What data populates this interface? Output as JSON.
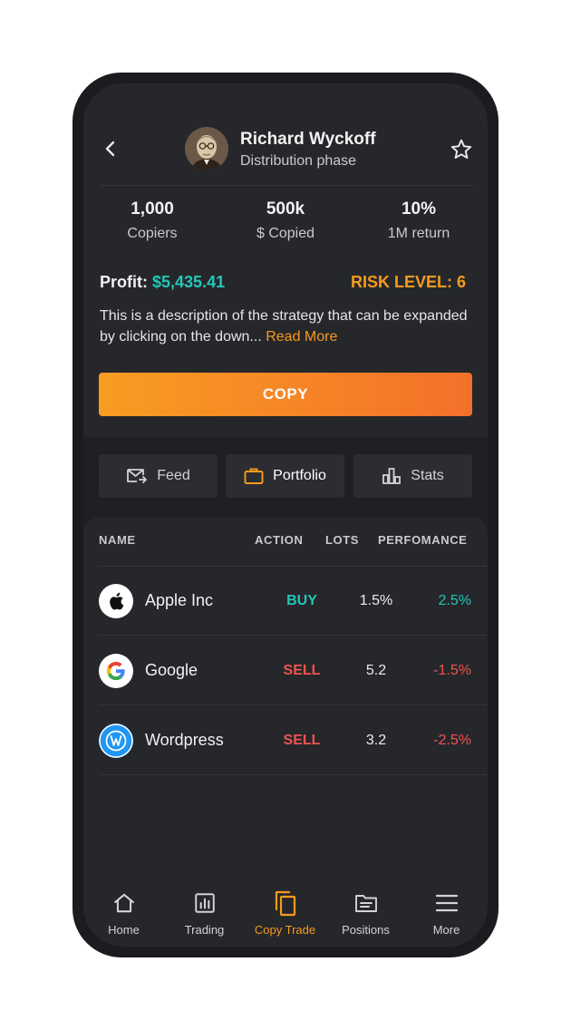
{
  "trader": {
    "name": "Richard Wyckoff",
    "subtitle": "Distribution phase"
  },
  "stats": [
    {
      "value": "1,000",
      "label": "Copiers"
    },
    {
      "value": "500k",
      "label": "$ Copied"
    },
    {
      "value": "10%",
      "label": "1M return"
    }
  ],
  "profit": {
    "label": "Profit:",
    "value": "$5,435.41"
  },
  "risk_level": "RISK LEVEL: 6",
  "description": {
    "text": "This is a description of the strategy that can be expanded by clicking on the down...",
    "read_more": "Read More"
  },
  "copy_button": "COPY",
  "tabs": [
    {
      "label": "Feed",
      "icon": "mail-forward-icon"
    },
    {
      "label": "Portfolio",
      "icon": "briefcase-icon",
      "active": true
    },
    {
      "label": "Stats",
      "icon": "bar-chart-icon"
    }
  ],
  "table": {
    "headers": {
      "name": "NAME",
      "action": "ACTION",
      "lots": "LOTS",
      "performance": "PERFOMANCE"
    },
    "rows": [
      {
        "name": "Apple Inc",
        "logo": "apple-logo",
        "action": "BUY",
        "lots": "1.5%",
        "performance": "2.5%"
      },
      {
        "name": "Google",
        "logo": "google-logo",
        "action": "SELL",
        "lots": "5.2",
        "performance": "-1.5%"
      },
      {
        "name": "Wordpress",
        "logo": "wordpress-logo",
        "action": "SELL",
        "lots": "3.2",
        "performance": "-2.5%"
      }
    ]
  },
  "nav": [
    {
      "label": "Home",
      "icon": "home-icon"
    },
    {
      "label": "Trading",
      "icon": "chart-icon"
    },
    {
      "label": "Copy Trade",
      "icon": "copy-icon",
      "active": true
    },
    {
      "label": "Positions",
      "icon": "folder-icon"
    },
    {
      "label": "More",
      "icon": "menu-icon"
    }
  ],
  "colors": {
    "accent": "#f79a1d",
    "positive": "#22c8b7",
    "negative": "#ef5350",
    "background": "#1f2024",
    "card": "#26272b"
  }
}
